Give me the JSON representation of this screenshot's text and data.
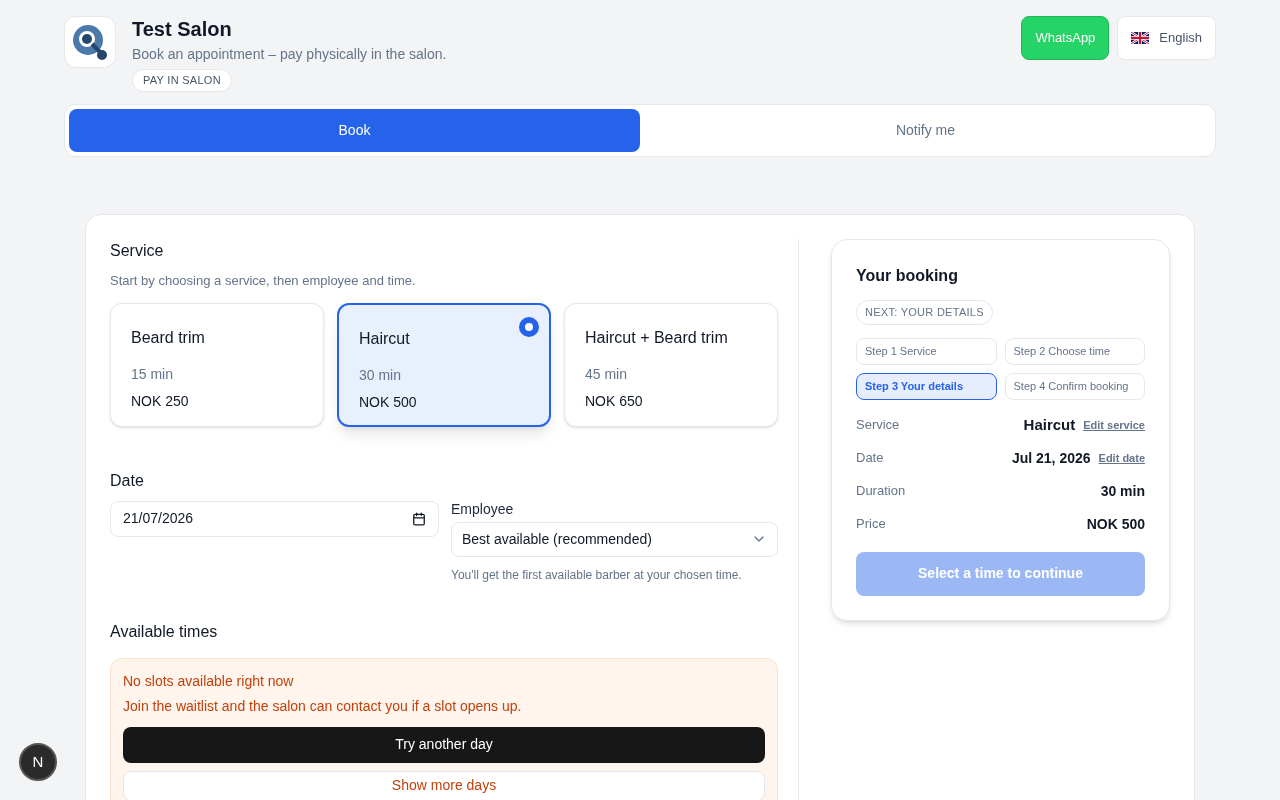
{
  "header": {
    "title": "Test Salon",
    "subtitle": "Book an appointment – pay physically in the salon.",
    "badge": "PAY IN SALON",
    "whatsapp": "WhatsApp",
    "language": "English"
  },
  "tabs": [
    {
      "label": "Book",
      "selected": true
    },
    {
      "label": "Notify me",
      "selected": false
    }
  ],
  "service": {
    "heading": "Service",
    "hint": "Start by choosing a service, then employee and time.",
    "options": [
      {
        "name": "Beard trim",
        "duration": "15 min",
        "price": "NOK 250",
        "selected": false
      },
      {
        "name": "Haircut",
        "duration": "30 min",
        "price": "NOK 500",
        "selected": true
      },
      {
        "name": "Haircut + Beard trim",
        "duration": "45 min",
        "price": "NOK 650",
        "selected": false
      }
    ]
  },
  "date": {
    "heading": "Date",
    "value": "21/07/2026"
  },
  "employee": {
    "label": "Employee",
    "value": "Best available (recommended)",
    "hint": "You'll get the first available barber at your chosen time."
  },
  "times": {
    "heading": "Available times",
    "alert_title": "No slots available right now",
    "alert_text": "Join the waitlist and the salon can contact you if a slot opens up.",
    "primary": "Try another day",
    "secondary": "Show more days"
  },
  "booking": {
    "title": "Your booking",
    "next": "NEXT: YOUR DETAILS",
    "steps": [
      {
        "label": "Step 1 Service",
        "selected": false
      },
      {
        "label": "Step 2 Choose time",
        "selected": false
      },
      {
        "label": "Step 3 Your details",
        "selected": true
      },
      {
        "label": "Step 4 Confirm booking",
        "selected": false
      }
    ],
    "rows": [
      {
        "label": "Service",
        "value": "Haircut",
        "link": "Edit service"
      },
      {
        "label": "Date",
        "value": "Jul 21, 2026",
        "link": "Edit date"
      },
      {
        "label": "Duration",
        "value": "30 min"
      },
      {
        "label": "Price",
        "value": "NOK 500"
      }
    ],
    "button": {
      "label": "Select a time to continue",
      "disabled": true
    }
  },
  "dev_badge": "N"
}
